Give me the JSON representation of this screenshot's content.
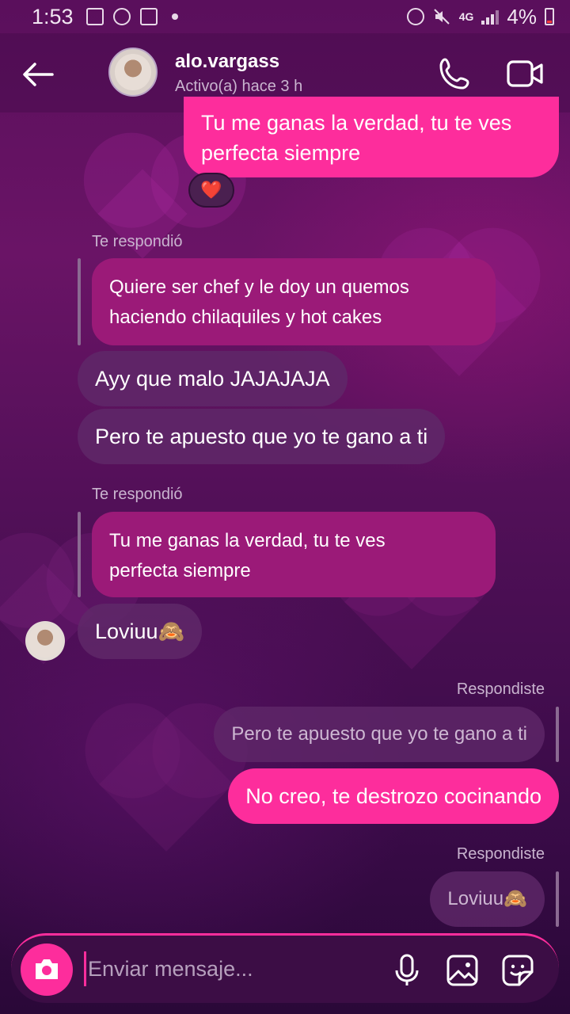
{
  "status_bar": {
    "time": "1:53",
    "network": "4G",
    "battery": "4%",
    "battery_color": "#ff3b3b"
  },
  "header": {
    "back_icon": "arrow-left-icon",
    "username": "alo.vargass",
    "status": "Activo(a) hace 3 h",
    "call_icon": "phone-icon",
    "video_icon": "video-camera-icon"
  },
  "colors": {
    "sent_bubble": "#fd2d9c",
    "received_bubble": "#5f2869",
    "quoted_bubble": "#9b1a78",
    "background_top": "#5a0f5c",
    "background_bottom": "#2a0838"
  },
  "messages": {
    "m1_sent_line1": "Tu me ganas la verdad, tu te ves",
    "m1_sent_line2": "perfecta siempre",
    "m1_reaction": "❤️",
    "r1_label": "Te respondió",
    "r1_quote_line1": "Quiere ser chef y le doy un quemos",
    "r1_quote_line2": "haciendo chilaquiles y hot cakes",
    "m2_recv": "Ayy que malo JAJAJAJA",
    "m3_recv": "Pero te apuesto que yo te gano a ti",
    "r2_label": "Te respondió",
    "r2_quote_line1": "Tu me ganas la verdad, tu te ves",
    "r2_quote_line2": "perfecta siempre",
    "m4_recv_text": "Loviuu",
    "m4_recv_emoji": "🙈",
    "r3_label": "Respondiste",
    "r3_quote": "Pero te apuesto que yo te gano a ti",
    "m5_sent": "No creo, te destrozo cocinando",
    "r4_label": "Respondiste",
    "r4_quote_text": "Loviuu",
    "r4_quote_emoji": "🙈"
  },
  "composer": {
    "camera_icon": "camera-icon",
    "placeholder": "Enviar mensaje...",
    "mic_icon": "microphone-icon",
    "gallery_icon": "image-icon",
    "sticker_icon": "sticker-icon"
  }
}
